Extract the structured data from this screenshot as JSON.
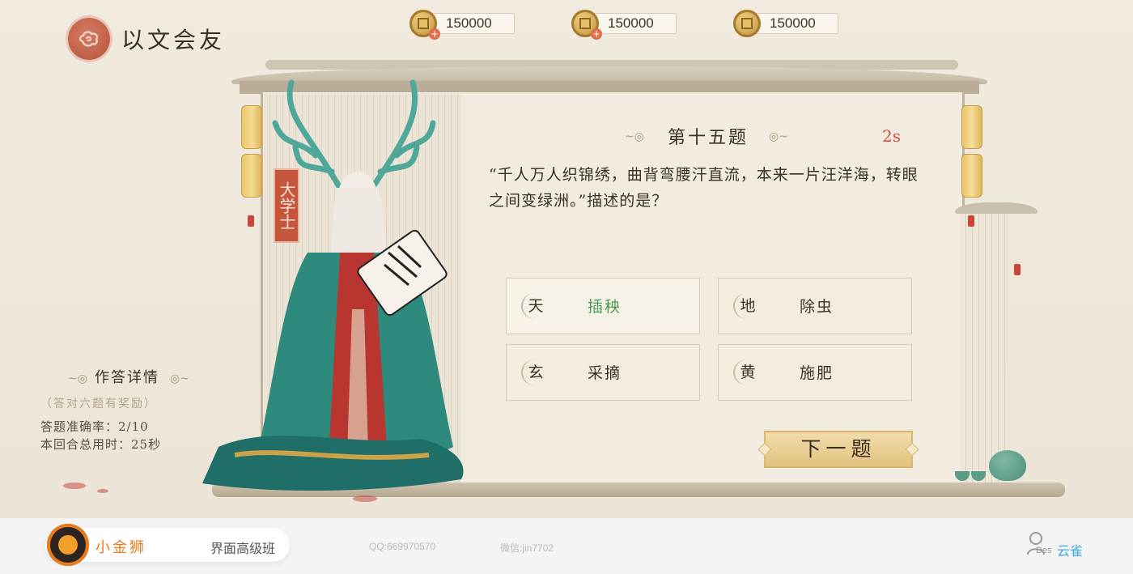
{
  "app": {
    "logo_text": "以文会友"
  },
  "currencies": [
    {
      "amount": "150000",
      "has_add": true
    },
    {
      "amount": "150000",
      "has_add": true
    },
    {
      "amount": "150000",
      "has_add": false
    }
  ],
  "character": {
    "title": "大学士"
  },
  "quiz": {
    "question_number": "第十五题",
    "timer": "2s",
    "question_text": "“千人万人织锦绣，曲背弯腰汗直流，本来一片汪洋海，转眼之间变绿洲。”描述的是？",
    "options": [
      {
        "mark": "天",
        "text": "插秧",
        "state": "highlighted"
      },
      {
        "mark": "地",
        "text": "除虫",
        "state": "normal"
      },
      {
        "mark": "玄",
        "text": "采摘",
        "state": "normal"
      },
      {
        "mark": "黄",
        "text": "施肥",
        "state": "normal"
      }
    ],
    "next_button": "下一题"
  },
  "details": {
    "title": "作答详情",
    "note": "（答对六题有奖励）",
    "accuracy": "答题准确率：2/10",
    "total_time": "本回合总用时：25秒"
  },
  "footer": {
    "brand": "小金狮",
    "course": "界面高级班",
    "qq": "QQ:669970570",
    "wechat": "微信:jin7702",
    "user_tag": "Des",
    "user_name": "云雀"
  },
  "colors": {
    "accent_red": "#d4503d",
    "correct_green": "#4b9a52",
    "brand_orange": "#e87c1b",
    "user_blue": "#3fa9e0"
  },
  "icons": [
    "cloud-logo-icon",
    "coin-icon",
    "plus-icon",
    "user-icon",
    "lion-avatar-icon"
  ]
}
